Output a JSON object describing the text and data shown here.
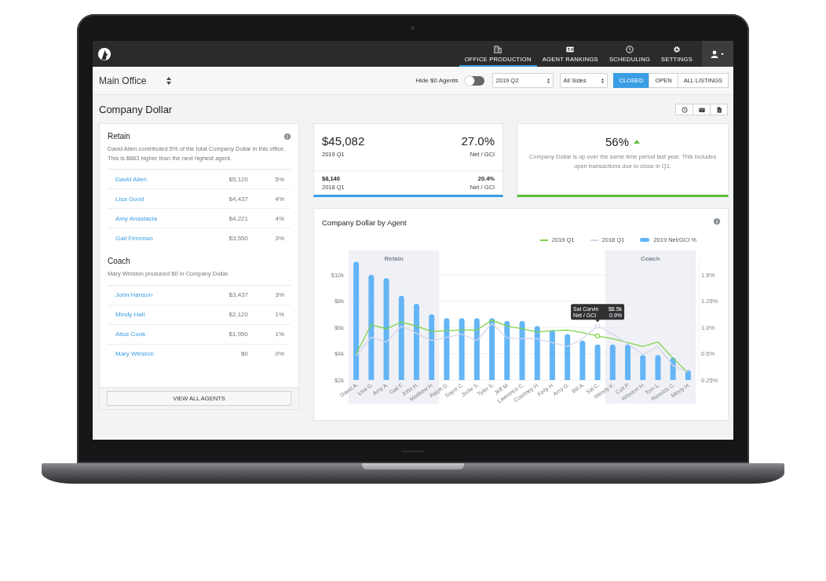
{
  "nav": {
    "items": [
      {
        "label": "OFFICE PRODUCTION",
        "kind": "building",
        "selected": true
      },
      {
        "label": "AGENT RANKINGS",
        "kind": "card",
        "selected": false
      },
      {
        "label": "SCHEDULING",
        "kind": "clock",
        "selected": false
      },
      {
        "label": "SETTINGS",
        "kind": "gear",
        "selected": false
      }
    ]
  },
  "toolbar": {
    "office": "Main Office",
    "hide_zero_label": "Hide $0 Agents",
    "hide_zero_on": false,
    "period": "2019 Q2",
    "sides": "All Sides",
    "segments": [
      {
        "label": "CLOSED",
        "selected": true
      },
      {
        "label": "OPEN",
        "selected": false
      },
      {
        "label": "ALL LISTINGS",
        "selected": false
      }
    ]
  },
  "page_title": "Company Dollar",
  "title_actions": [
    {
      "kind": "clock"
    },
    {
      "kind": "mail"
    },
    {
      "kind": "document"
    }
  ],
  "groups": [
    {
      "title": "Retain",
      "summary": "David Allen contributed 5% of the total Company Dollar in this office. This is $683 higher than the next highest agent.",
      "agents": [
        {
          "name": "David Allen",
          "amount": "$5,120",
          "share": "5%"
        },
        {
          "name": "Lisa Good",
          "amount": "$4,437",
          "share": "4%"
        },
        {
          "name": "Amy Anastacia",
          "amount": "$4,221",
          "share": "4%"
        },
        {
          "name": "Gail Finnman",
          "amount": "$3,550",
          "share": "3%"
        }
      ]
    },
    {
      "title": "Coach",
      "summary": "Mary Winston produced $0 in Company Dollar.",
      "agents": [
        {
          "name": "John Hanson",
          "amount": "$3,437",
          "share": "3%"
        },
        {
          "name": "Mindy Hall",
          "amount": "$2,120",
          "share": "1%"
        },
        {
          "name": "Alice Cook",
          "amount": "$1,950",
          "share": "1%"
        },
        {
          "name": "Mary Winston",
          "amount": "$0",
          "share": "0%"
        }
      ]
    }
  ],
  "view_all": "VIEW ALL AGENTS",
  "stat": {
    "value": "$45,082",
    "period": "2019 Q1",
    "ratio": "27.0%",
    "ratio_label": "Net / GCI",
    "prev_value": "$8,140",
    "prev_period": "2018 Q1",
    "prev_ratio": "20.4%",
    "prev_ratio_label": "Net / GCI"
  },
  "change": {
    "value": "56%",
    "trend_up": true,
    "text": "Company Dollar is up over the same time period last year. This includes open transactions due to close in Q1."
  },
  "chart": {
    "right_axis_labels": [
      "1.5%",
      "1.25%",
      "1.0%",
      "0.5%",
      "0.25%"
    ],
    "bands": [
      {
        "label": "Retain"
      },
      {
        "label": "Coach"
      }
    ],
    "tooltip": {
      "lines": [
        [
          "Sal Corvin",
          "$8.5k"
        ],
        [
          "Net / GCI",
          "0.9%"
        ]
      ]
    },
    "chart_data": {
      "type": "bar",
      "title": "Company Dollar by Agent",
      "categories": [
        "David A.",
        "Lisa G.",
        "Amy A.",
        "Gail F.",
        "John H.",
        "Matthew H.",
        "Ralph G.",
        "Sayre C.",
        "Jodie S.",
        "Tyler S.",
        "Jeff M.",
        "Lawrence C.",
        "Courtney H.",
        "Kelly H.",
        "Amy G.",
        "Bill A.",
        "Sal C.",
        "Wendy K.",
        "Colt P.",
        "Winston H.",
        "Tom L.",
        "Renolds C.",
        "Mindy H."
      ],
      "series": [
        {
          "name": "2019 Q1",
          "type": "line",
          "color": "#7ed348",
          "values": [
            4000,
            6200,
            5900,
            6400,
            6100,
            5700,
            5750,
            5800,
            5800,
            6550,
            6100,
            5900,
            5650,
            5750,
            5800,
            5600,
            5350,
            5150,
            4850,
            4550,
            4900,
            3650,
            2550
          ]
        },
        {
          "name": "2018 Q1",
          "type": "line",
          "color": "#d6d6ea",
          "values": [
            3850,
            5250,
            4900,
            6100,
            5550,
            5000,
            5250,
            5500,
            5000,
            6300,
            5200,
            5150,
            5150,
            4850,
            4550,
            5150,
            6100,
            5500,
            4750,
            3950,
            4550,
            3100,
            2600
          ]
        },
        {
          "name": "2019 Net/GCI %",
          "type": "bar",
          "color": "#64b5f6",
          "values": [
            11000,
            10000,
            9750,
            8400,
            7800,
            7000,
            6700,
            6700,
            6700,
            6700,
            6500,
            6500,
            6100,
            5800,
            5500,
            5000,
            4700,
            4700,
            4700,
            3900,
            3900,
            3700,
            2750
          ]
        }
      ],
      "ylim": [
        2000,
        11200
      ],
      "grid": true,
      "yticks": [
        {
          "value": 2000,
          "label": "$2k"
        },
        {
          "value": 4000,
          "label": "$4k"
        },
        {
          "value": 6000,
          "label": "$6k"
        },
        {
          "value": 8000,
          "label": "$8k"
        },
        {
          "value": 10000,
          "label": "$10k"
        }
      ]
    }
  }
}
